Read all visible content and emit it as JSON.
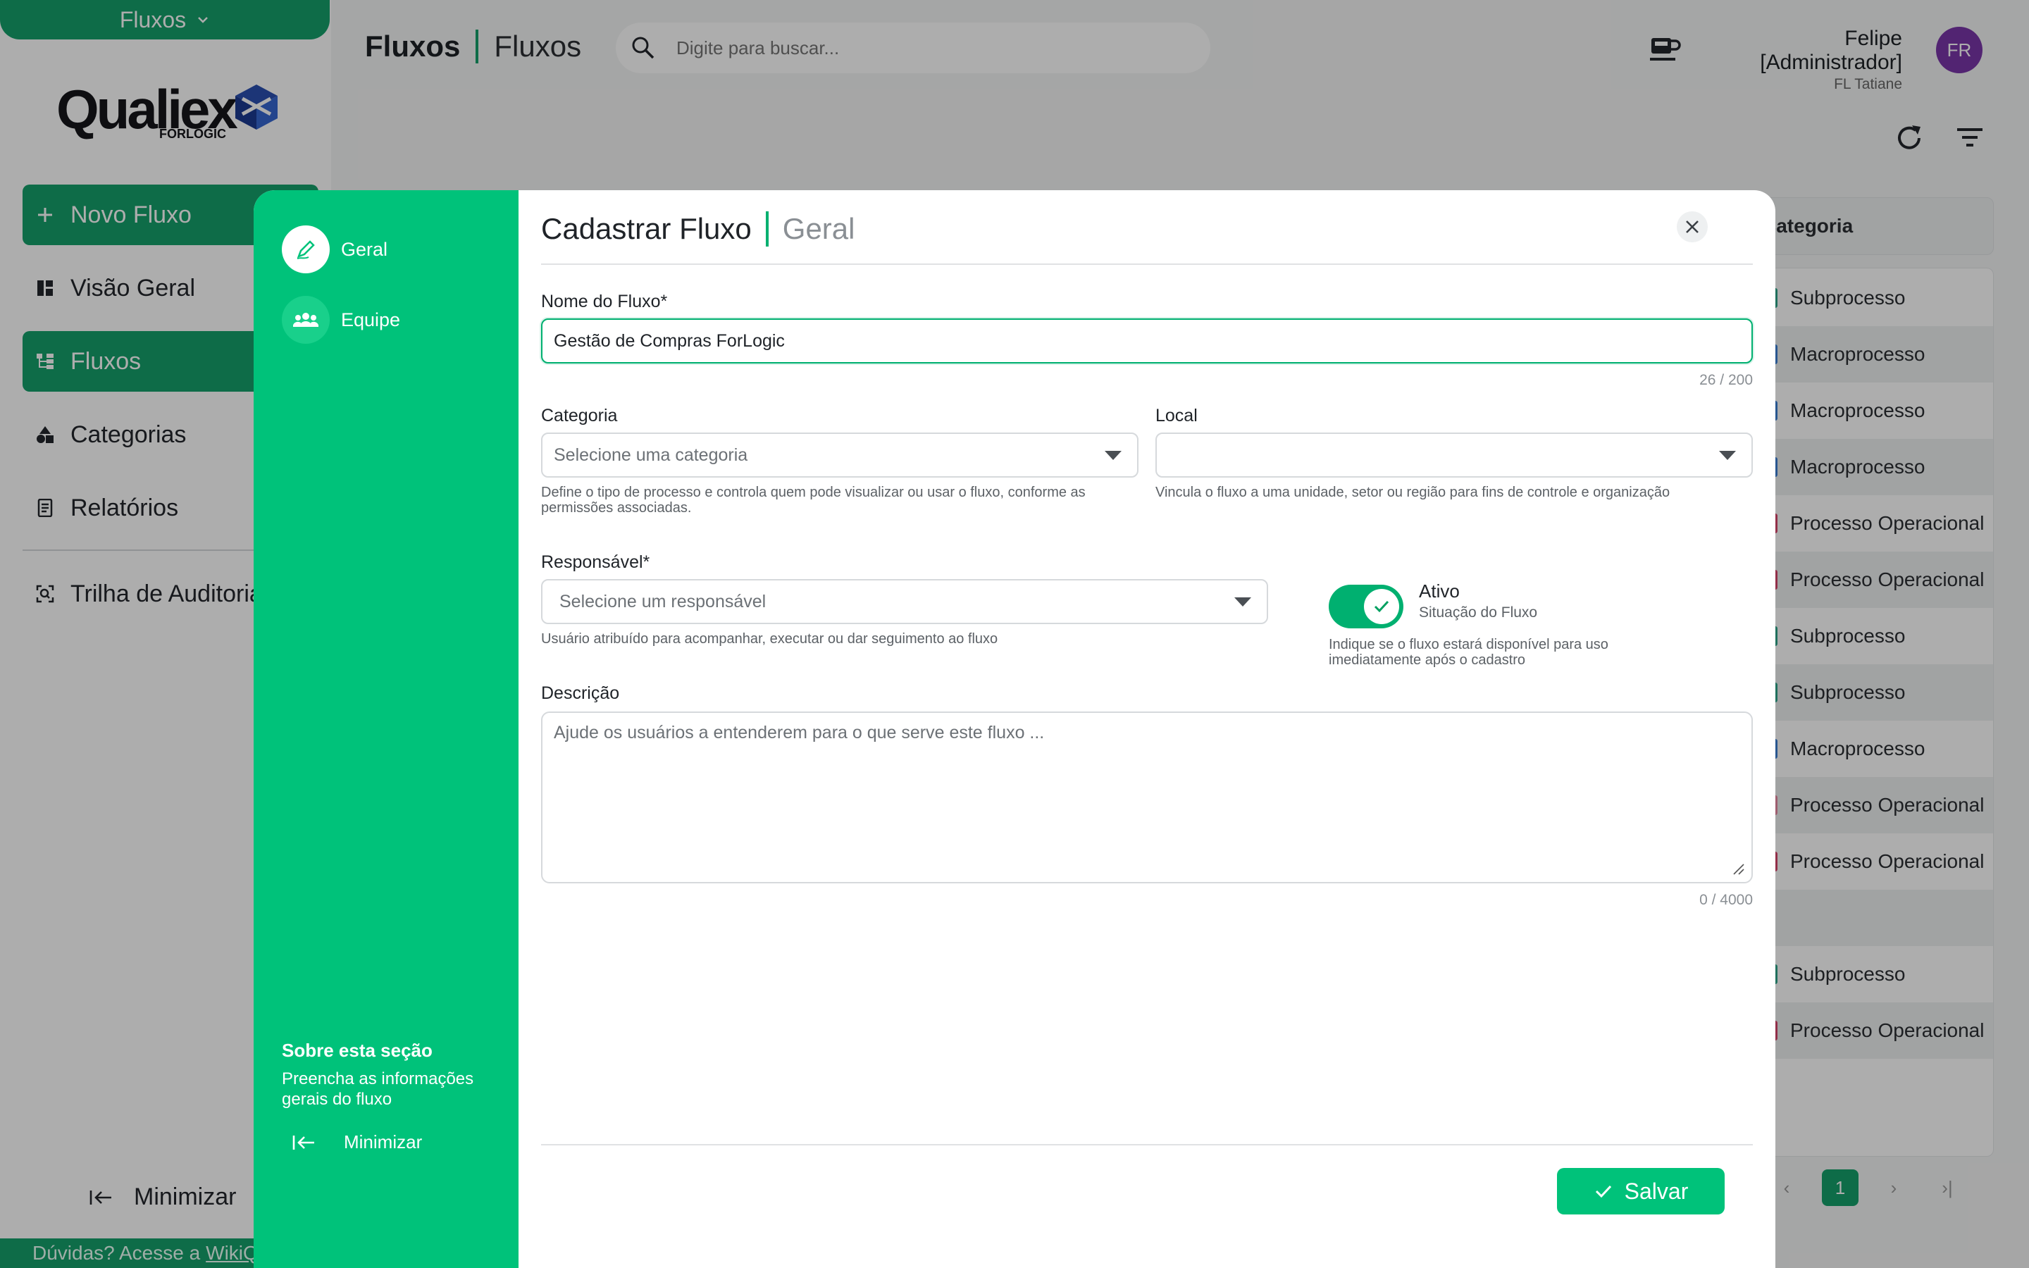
{
  "app": {
    "module_label": "Fluxos",
    "logo_text": "Qualiex",
    "logo_sub": "FORLOGIC"
  },
  "sidebar": {
    "new_flow_label": "Novo Fluxo",
    "items": [
      {
        "label": "Visão Geral",
        "icon": "dashboard-icon"
      },
      {
        "label": "Fluxos",
        "icon": "flows-icon"
      },
      {
        "label": "Categorias",
        "icon": "categories-icon"
      },
      {
        "label": "Relatórios",
        "icon": "reports-icon"
      },
      {
        "label": "Trilha de Auditoria",
        "icon": "audit-icon"
      }
    ],
    "minimize_label": "Minimizar",
    "help_text": "Dúvidas? Acesse a",
    "help_link": "WikiQ"
  },
  "header": {
    "crumb_main": "Fluxos",
    "crumb_sub": "Fluxos",
    "search_placeholder": "Digite para buscar...",
    "user_name": "Felipe [Administrador]",
    "user_org": "FL Tatiane",
    "avatar_initials": "FR"
  },
  "table": {
    "column_header": "Categoria",
    "rows": [
      {
        "category": "Subprocesso",
        "color": "#2fa58a"
      },
      {
        "category": "Macroprocesso",
        "color": "#3b7fd4"
      },
      {
        "category": "Macroprocesso",
        "color": "#3b7fd4"
      },
      {
        "category": "Macroprocesso",
        "color": "#3b7fd4"
      },
      {
        "category": "Processo Operacional",
        "color": "#d8446a"
      },
      {
        "category": "Processo Operacional",
        "color": "#d8446a"
      },
      {
        "category": "Subprocesso",
        "color": "#2fa58a"
      },
      {
        "category": "Subprocesso",
        "color": "#2fa58a"
      },
      {
        "category": "Macroprocesso",
        "color": "#3b7fd4"
      },
      {
        "category": "Processo Operacional",
        "color": "#e98aa2"
      },
      {
        "category": "Processo Operacional",
        "color": "#d8446a"
      },
      {
        "category": "",
        "color": ""
      },
      {
        "category": "Subprocesso",
        "color": "#2fa58a"
      },
      {
        "category": "Processo Operacional",
        "color": "#d8446a"
      }
    ],
    "current_page": "1"
  },
  "modal": {
    "title": "Cadastrar Fluxo",
    "subtitle": "Geral",
    "steps": [
      {
        "label": "Geral",
        "active": true
      },
      {
        "label": "Equipe",
        "active": false
      }
    ],
    "about_title": "Sobre esta seção",
    "about_text": "Preencha as informações gerais do fluxo",
    "minimize_label": "Minimizar",
    "name_label": "Nome do Fluxo*",
    "name_value": "Gestão de Compras ForLogic",
    "name_counter": "26 / 200",
    "category_label": "Categoria",
    "category_placeholder": "Selecione uma categoria",
    "category_hint": "Define o tipo de processo e controla quem pode visualizar ou usar o fluxo, conforme as permissões associadas.",
    "local_label": "Local",
    "local_value": "",
    "local_hint": "Vincula o fluxo a uma unidade, setor ou região para fins de controle e organização",
    "owner_label": "Responsável*",
    "owner_placeholder": "Selecione um responsável",
    "owner_hint": "Usuário atribuído para acompanhar, executar ou dar seguimento ao fluxo",
    "active_label": "Ativo",
    "active_sub": "Situação do Fluxo",
    "active_on": true,
    "active_hint": "Indique se o fluxo estará disponível para uso imediatamente após o cadastro",
    "description_label": "Descrição",
    "description_placeholder": "Ajude os usuários a entenderem para o que serve este fluxo ...",
    "description_counter": "0 / 4000",
    "save_label": "Salvar"
  },
  "colors": {
    "brand": "#16a06a",
    "modal_side": "#00c27a",
    "accent": "#00b070"
  }
}
